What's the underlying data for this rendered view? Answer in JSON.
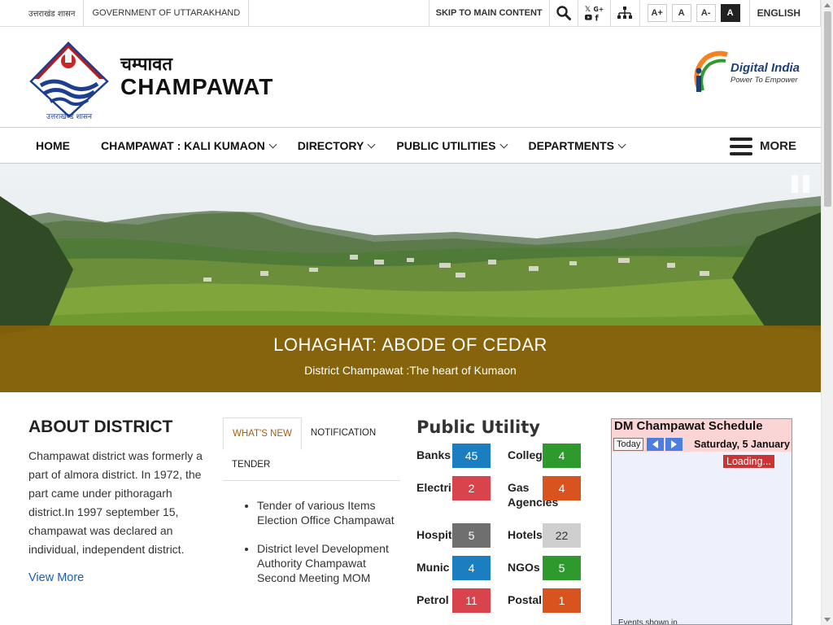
{
  "topbar": {
    "gov_hindi": "उत्तराखंड शासन",
    "gov_english": "GOVERNMENT OF UTTARAKHAND",
    "skip": "SKIP TO MAIN CONTENT",
    "font_increase": "A+",
    "font_normal": "A",
    "font_decrease": "A-",
    "high_contrast": "A",
    "language": "ENGLISH"
  },
  "header": {
    "emblem_caption": "उत्तराखण्ड शासन",
    "title_hindi": "चम्पावत",
    "title": "CHAMPAWAT",
    "partner_logo_title": "Digital India",
    "partner_logo_tagline": "Power To Empower"
  },
  "nav": {
    "items": [
      {
        "label": "HOME",
        "has_dropdown": false
      },
      {
        "label": "CHAMPAWAT : KALI KUMAON",
        "has_dropdown": true
      },
      {
        "label": "DIRECTORY",
        "has_dropdown": true
      },
      {
        "label": "PUBLIC UTILITIES",
        "has_dropdown": true
      },
      {
        "label": "DEPARTMENTS",
        "has_dropdown": true
      }
    ],
    "more_label": "MORE"
  },
  "banner": {
    "title": "LOHAGHAT: ABODE OF CEDAR",
    "subtitle": "District Champawat :The heart of Kumaon"
  },
  "about": {
    "heading": "ABOUT DISTRICT",
    "text": "Champawat district was formerly a part of almora district. In 1972, the part came under pithoragarh district.In 1997 september 15, champawat was declared an individual, independent district.",
    "link": "View More"
  },
  "tabs": {
    "items": [
      {
        "label": "WHAT'S NEW",
        "active": true
      },
      {
        "label": "NOTIFICATION",
        "active": false
      },
      {
        "label": "TENDER",
        "active": false
      }
    ],
    "news": [
      "Tender of various Items Election Office Champawat",
      "District level Development Authority Champawat Second Meeting MOM"
    ]
  },
  "utility": {
    "heading": "Public Utility",
    "items": [
      {
        "label": "Banks",
        "count": "45",
        "color": "#1a7ec0"
      },
      {
        "label": "Colleg",
        "count": "4",
        "color": "#2e9a2e"
      },
      {
        "label": "Electri",
        "count": "2",
        "color": "#d9434b"
      },
      {
        "label": "Gas Agencies",
        "count": "4",
        "color": "#d9531e"
      },
      {
        "label": "Hospit",
        "count": "5",
        "color": "#6f6f6f"
      },
      {
        "label": "Hotels",
        "count": "22",
        "color": "#cfcfcf"
      },
      {
        "label": "Munic      s",
        "count": "4",
        "color": "#1a7ec0"
      },
      {
        "label": "NGOs",
        "count": "5",
        "color": "#2e9a2e"
      },
      {
        "label": "Petrol Pumps",
        "count": "11",
        "color": "#d9434b"
      },
      {
        "label": "Postal",
        "count": "1",
        "color": "#d9531e"
      }
    ]
  },
  "calendar": {
    "title": "DM Champawat Schedule",
    "today": "Today",
    "date": "Saturday, 5 January",
    "loading": "Loading...",
    "footer": "Events shown in"
  },
  "colors": {
    "caption_bg": "#875f0a",
    "active_tab": "#a35d0e",
    "link": "#1a5fb4"
  },
  "icons": [
    "search-icon",
    "social-icon",
    "sitemap-icon",
    "menu-icon",
    "chevron-down-icon",
    "pause-icon",
    "prev-arrow-icon",
    "next-arrow-icon"
  ]
}
